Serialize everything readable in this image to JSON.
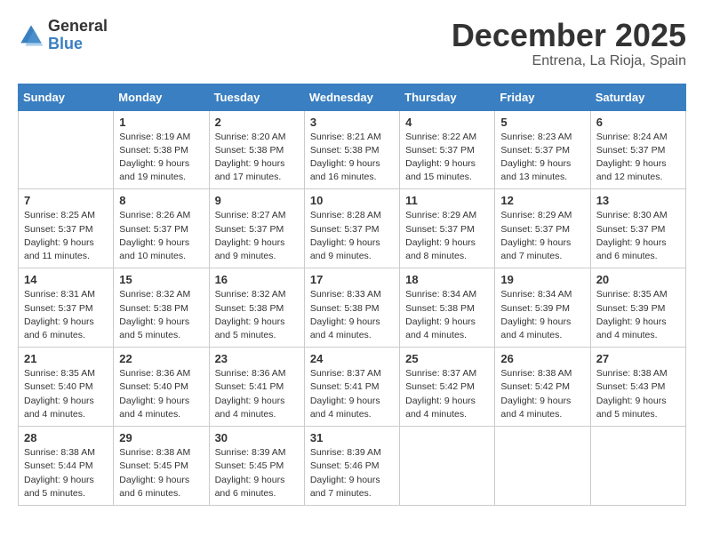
{
  "header": {
    "logo_general": "General",
    "logo_blue": "Blue",
    "month_title": "December 2025",
    "location": "Entrena, La Rioja, Spain"
  },
  "days_of_week": [
    "Sunday",
    "Monday",
    "Tuesday",
    "Wednesday",
    "Thursday",
    "Friday",
    "Saturday"
  ],
  "weeks": [
    [
      {
        "num": "",
        "info": ""
      },
      {
        "num": "1",
        "info": "Sunrise: 8:19 AM\nSunset: 5:38 PM\nDaylight: 9 hours\nand 19 minutes."
      },
      {
        "num": "2",
        "info": "Sunrise: 8:20 AM\nSunset: 5:38 PM\nDaylight: 9 hours\nand 17 minutes."
      },
      {
        "num": "3",
        "info": "Sunrise: 8:21 AM\nSunset: 5:38 PM\nDaylight: 9 hours\nand 16 minutes."
      },
      {
        "num": "4",
        "info": "Sunrise: 8:22 AM\nSunset: 5:37 PM\nDaylight: 9 hours\nand 15 minutes."
      },
      {
        "num": "5",
        "info": "Sunrise: 8:23 AM\nSunset: 5:37 PM\nDaylight: 9 hours\nand 13 minutes."
      },
      {
        "num": "6",
        "info": "Sunrise: 8:24 AM\nSunset: 5:37 PM\nDaylight: 9 hours\nand 12 minutes."
      }
    ],
    [
      {
        "num": "7",
        "info": "Sunrise: 8:25 AM\nSunset: 5:37 PM\nDaylight: 9 hours\nand 11 minutes."
      },
      {
        "num": "8",
        "info": "Sunrise: 8:26 AM\nSunset: 5:37 PM\nDaylight: 9 hours\nand 10 minutes."
      },
      {
        "num": "9",
        "info": "Sunrise: 8:27 AM\nSunset: 5:37 PM\nDaylight: 9 hours\nand 9 minutes."
      },
      {
        "num": "10",
        "info": "Sunrise: 8:28 AM\nSunset: 5:37 PM\nDaylight: 9 hours\nand 9 minutes."
      },
      {
        "num": "11",
        "info": "Sunrise: 8:29 AM\nSunset: 5:37 PM\nDaylight: 9 hours\nand 8 minutes."
      },
      {
        "num": "12",
        "info": "Sunrise: 8:29 AM\nSunset: 5:37 PM\nDaylight: 9 hours\nand 7 minutes."
      },
      {
        "num": "13",
        "info": "Sunrise: 8:30 AM\nSunset: 5:37 PM\nDaylight: 9 hours\nand 6 minutes."
      }
    ],
    [
      {
        "num": "14",
        "info": "Sunrise: 8:31 AM\nSunset: 5:37 PM\nDaylight: 9 hours\nand 6 minutes."
      },
      {
        "num": "15",
        "info": "Sunrise: 8:32 AM\nSunset: 5:38 PM\nDaylight: 9 hours\nand 5 minutes."
      },
      {
        "num": "16",
        "info": "Sunrise: 8:32 AM\nSunset: 5:38 PM\nDaylight: 9 hours\nand 5 minutes."
      },
      {
        "num": "17",
        "info": "Sunrise: 8:33 AM\nSunset: 5:38 PM\nDaylight: 9 hours\nand 4 minutes."
      },
      {
        "num": "18",
        "info": "Sunrise: 8:34 AM\nSunset: 5:38 PM\nDaylight: 9 hours\nand 4 minutes."
      },
      {
        "num": "19",
        "info": "Sunrise: 8:34 AM\nSunset: 5:39 PM\nDaylight: 9 hours\nand 4 minutes."
      },
      {
        "num": "20",
        "info": "Sunrise: 8:35 AM\nSunset: 5:39 PM\nDaylight: 9 hours\nand 4 minutes."
      }
    ],
    [
      {
        "num": "21",
        "info": "Sunrise: 8:35 AM\nSunset: 5:40 PM\nDaylight: 9 hours\nand 4 minutes."
      },
      {
        "num": "22",
        "info": "Sunrise: 8:36 AM\nSunset: 5:40 PM\nDaylight: 9 hours\nand 4 minutes."
      },
      {
        "num": "23",
        "info": "Sunrise: 8:36 AM\nSunset: 5:41 PM\nDaylight: 9 hours\nand 4 minutes."
      },
      {
        "num": "24",
        "info": "Sunrise: 8:37 AM\nSunset: 5:41 PM\nDaylight: 9 hours\nand 4 minutes."
      },
      {
        "num": "25",
        "info": "Sunrise: 8:37 AM\nSunset: 5:42 PM\nDaylight: 9 hours\nand 4 minutes."
      },
      {
        "num": "26",
        "info": "Sunrise: 8:38 AM\nSunset: 5:42 PM\nDaylight: 9 hours\nand 4 minutes."
      },
      {
        "num": "27",
        "info": "Sunrise: 8:38 AM\nSunset: 5:43 PM\nDaylight: 9 hours\nand 5 minutes."
      }
    ],
    [
      {
        "num": "28",
        "info": "Sunrise: 8:38 AM\nSunset: 5:44 PM\nDaylight: 9 hours\nand 5 minutes."
      },
      {
        "num": "29",
        "info": "Sunrise: 8:38 AM\nSunset: 5:45 PM\nDaylight: 9 hours\nand 6 minutes."
      },
      {
        "num": "30",
        "info": "Sunrise: 8:39 AM\nSunset: 5:45 PM\nDaylight: 9 hours\nand 6 minutes."
      },
      {
        "num": "31",
        "info": "Sunrise: 8:39 AM\nSunset: 5:46 PM\nDaylight: 9 hours\nand 7 minutes."
      },
      {
        "num": "",
        "info": ""
      },
      {
        "num": "",
        "info": ""
      },
      {
        "num": "",
        "info": ""
      }
    ]
  ]
}
